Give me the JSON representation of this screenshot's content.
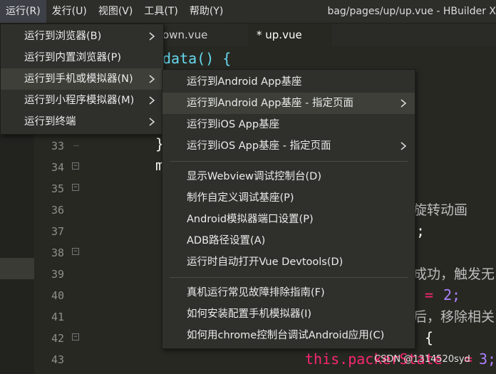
{
  "menubar": {
    "items": [
      "运行(R)",
      "发行(U)",
      "视图(V)",
      "工具(T)",
      "帮助(Y)"
    ],
    "title": "bag/pages/up/up.vue - HBuilder X"
  },
  "tabs": [
    "own.vue",
    "* up.vue"
  ],
  "editor": {
    "line_numbers": [
      "33",
      "34",
      "35",
      "36",
      "37",
      "38",
      "39",
      "40",
      "41",
      "42",
      "43"
    ],
    "code_fragments": {
      "data_fn": "data() {",
      "brace33": "}",
      "m34": "m",
      "comment36": "旋转动画",
      "semi37": ";",
      "comment39": "成功，触发无",
      "eq40": "=",
      "val40": "2;",
      "comment41": "后，移除相关",
      "brace42": "{",
      "this43": "this.packerState",
      "eq43": "=",
      "val43": "3;"
    }
  },
  "watermark": "CSDN @1314520syd",
  "run_menu": {
    "items": [
      {
        "label": "运行到浏览器(B)",
        "submenu": true
      },
      {
        "label": "运行到内置浏览器(P)",
        "submenu": false
      },
      {
        "label": "运行到手机或模拟器(N)",
        "submenu": true
      },
      {
        "label": "运行到小程序模拟器(M)",
        "submenu": true
      },
      {
        "label": "运行到终端",
        "submenu": true
      }
    ]
  },
  "device_submenu": {
    "items": [
      {
        "label": "运行到Android App基座",
        "submenu": false
      },
      {
        "label": "运行到Android App基座 - 指定页面",
        "submenu": true
      },
      {
        "label": "运行到iOS App基座",
        "submenu": false
      },
      {
        "label": "运行到iOS App基座 - 指定页面",
        "submenu": true
      },
      {
        "label": "显示Webview调试控制台(D)",
        "submenu": false
      },
      {
        "label": "制作自定义调试基座(P)",
        "submenu": false
      },
      {
        "label": "Android模拟器端口设置(P)",
        "submenu": false
      },
      {
        "label": "ADB路径设置(A)",
        "submenu": false
      },
      {
        "label": "运行时自动打开Vue Devtools(D)",
        "submenu": false
      },
      {
        "label": "真机运行常见故障排除指南(F)",
        "submenu": false
      },
      {
        "label": "如何安装配置手机模拟器(I)",
        "submenu": false
      },
      {
        "label": "如何用chrome控制台调试Android应用(C)",
        "submenu": false
      }
    ]
  }
}
